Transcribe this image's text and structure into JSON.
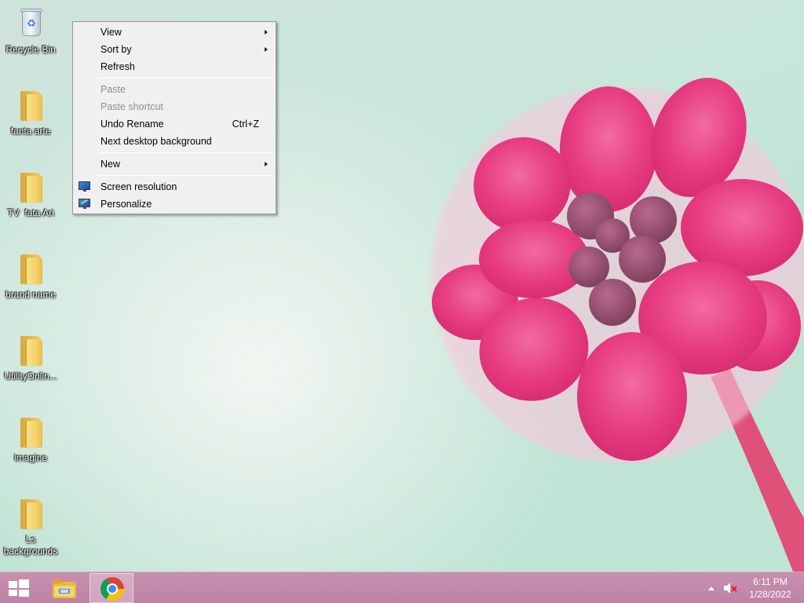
{
  "desktop": {
    "icons": [
      {
        "label": "Recycle Bin",
        "type": "recycle-bin"
      },
      {
        "label": "fanta arte",
        "type": "folder"
      },
      {
        "label": "TV  fata Ari",
        "type": "folder"
      },
      {
        "label": "brand name",
        "type": "folder"
      },
      {
        "label": "UtilityOnlin...",
        "type": "folder"
      },
      {
        "label": "imagine",
        "type": "folder"
      },
      {
        "label": "Ls\nbackgrounds",
        "type": "folder"
      }
    ]
  },
  "context_menu": {
    "items": [
      {
        "label": "View",
        "submenu": true
      },
      {
        "label": "Sort by",
        "submenu": true
      },
      {
        "label": "Refresh"
      },
      {
        "label": "Paste",
        "disabled": true
      },
      {
        "label": "Paste shortcut",
        "disabled": true
      },
      {
        "label": "Undo Rename",
        "shortcut": "Ctrl+Z"
      },
      {
        "label": "Next desktop background"
      },
      {
        "label": "New",
        "submenu": true
      },
      {
        "label": "Screen resolution",
        "icon": "display-icon"
      },
      {
        "label": "Personalize",
        "icon": "personalize-icon"
      }
    ]
  },
  "taskbar": {
    "start_icon": "windows-logo-icon",
    "pinned": [
      {
        "name": "File Explorer",
        "icon": "file-explorer-icon"
      },
      {
        "name": "Google Chrome",
        "icon": "chrome-icon",
        "active": true
      }
    ],
    "tray": {
      "volume_state": "muted",
      "time": "6:11 PM",
      "date": "1/28/2022"
    }
  },
  "colors": {
    "taskbar": "#c088aa",
    "flower": "#e83d82",
    "menu_bg": "#f0f0f0"
  }
}
